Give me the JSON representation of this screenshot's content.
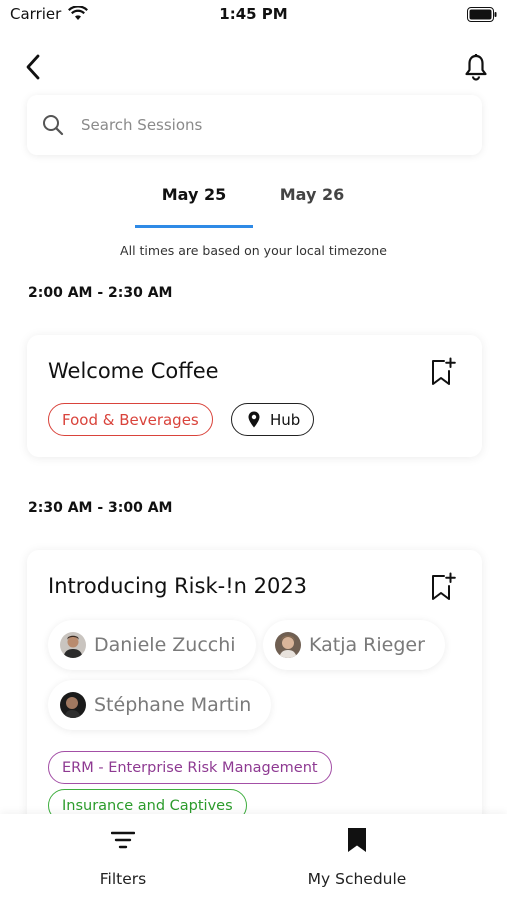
{
  "status_bar": {
    "carrier": "Carrier",
    "time": "1:45 PM"
  },
  "nav": {
    "back_icon": "chevron-left-icon",
    "notification_icon": "bell-icon"
  },
  "search": {
    "placeholder": "Search Sessions",
    "value": ""
  },
  "tabs": [
    {
      "label": "May 25",
      "active": true
    },
    {
      "label": "May 26",
      "active": false
    }
  ],
  "timezone_note": "All times are based on your local timezone",
  "sessions": [
    {
      "time_range": "2:00 AM - 2:30 AM",
      "title": "Welcome Coffee",
      "tags": [
        {
          "label": "Food & Beverages",
          "color": "#d9433b"
        }
      ],
      "location": "Hub"
    },
    {
      "time_range": "2:30 AM - 3:00 AM",
      "title": "Introducing Risk-!n 2023",
      "speakers": [
        {
          "name": "Daniele Zucchi"
        },
        {
          "name": "Katja Rieger"
        },
        {
          "name": "Stéphane Martin"
        }
      ],
      "tags": [
        {
          "label": "ERM - Enterprise Risk Management",
          "color": "#a34fa6"
        },
        {
          "label": "Insurance and Captives",
          "color": "#3fae3f"
        }
      ]
    }
  ],
  "bottom_nav": [
    {
      "label": "Filters",
      "icon": "filter-icon"
    },
    {
      "label": "My Schedule",
      "icon": "bookmark-icon"
    }
  ],
  "colors": {
    "accent": "#2f8ae6"
  }
}
